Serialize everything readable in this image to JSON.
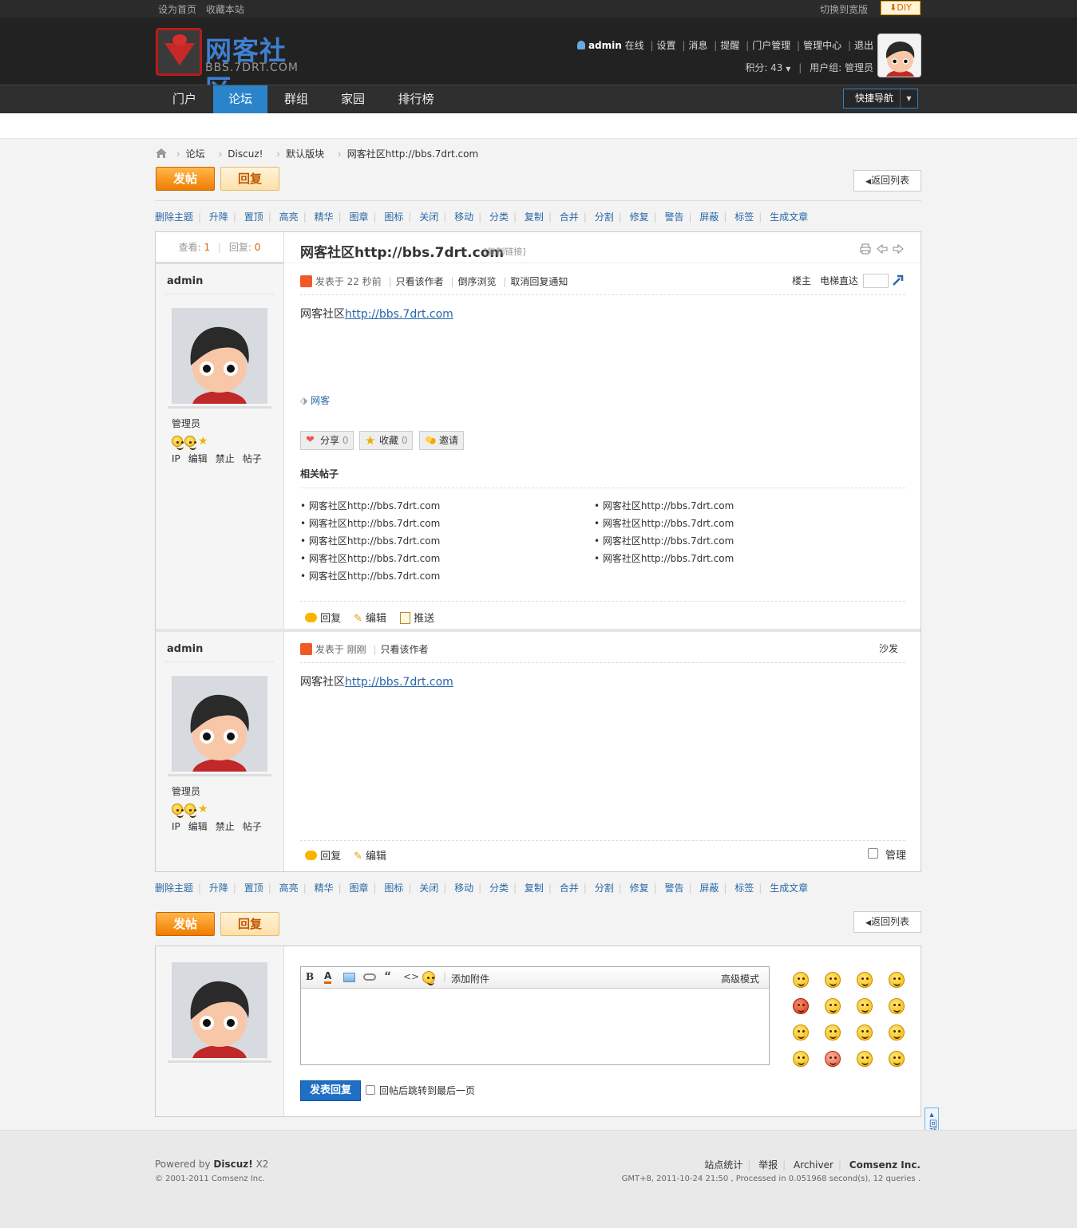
{
  "topbar": {
    "set_home": "设为首页",
    "bookmark": "收藏本站",
    "wide": "切换到宽版",
    "diy": "DIY"
  },
  "logo": {
    "name": "网客社区",
    "domain": "BBS.7DRT.COM"
  },
  "user": {
    "name": "admin",
    "status": "在线",
    "links": [
      "设置",
      "消息",
      "提醒",
      "门户管理",
      "管理中心",
      "退出"
    ],
    "points_label": "积分: 43",
    "group_label": "用户组: 管理员"
  },
  "nav": {
    "items": [
      "门户",
      "论坛",
      "群组",
      "家园",
      "排行榜"
    ],
    "active": "论坛",
    "quick": "快捷导航"
  },
  "breadcrumb": [
    "论坛",
    "Discuz!",
    "默认版块",
    "网客社区http://bbs.7drt.com"
  ],
  "buttons": {
    "post": "发帖",
    "reply": "回复",
    "back": "返回列表"
  },
  "modbar": [
    "删除主题",
    "升降",
    "置顶",
    "高亮",
    "精华",
    "图章",
    "图标",
    "关闭",
    "移动",
    "分类",
    "复制",
    "合并",
    "分割",
    "修复",
    "警告",
    "屏蔽",
    "标签",
    "生成文章"
  ],
  "thread": {
    "views_label": "查看:",
    "views": "1",
    "replies_label": "回复:",
    "replies": "0",
    "title": "网客社区http://bbs.7drt.com",
    "copy_link": "[复制链接]"
  },
  "post1": {
    "author": "admin",
    "posted": "发表于 22 秒前",
    "only_author": "只看该作者",
    "reverse": "倒序浏览",
    "cancel_notify": "取消回复通知",
    "floor": "楼主",
    "jump_label": "电梯直达",
    "content_text": "网客社区",
    "content_link": "http://bbs.7drt.com",
    "tag": "网客",
    "share": "分享",
    "share_count": "0",
    "fav": "收藏",
    "fav_count": "0",
    "invite": "邀请",
    "related_title": "相关帖子",
    "related": [
      "网客社区http://bbs.7drt.com",
      "网客社区http://bbs.7drt.com",
      "网客社区http://bbs.7drt.com",
      "网客社区http://bbs.7drt.com",
      "网客社区http://bbs.7drt.com",
      "网客社区http://bbs.7drt.com",
      "网客社区http://bbs.7drt.com",
      "网客社区http://bbs.7drt.com",
      "网客社区http://bbs.7drt.com"
    ],
    "actions": [
      "回复",
      "编辑",
      "推送"
    ]
  },
  "post2": {
    "author": "admin",
    "posted": "发表于 刚刚",
    "only_author": "只看该作者",
    "floor": "沙发",
    "content_text": "网客社区",
    "content_link": "http://bbs.7drt.com",
    "actions": [
      "回复",
      "编辑"
    ],
    "manage": "管理"
  },
  "side": {
    "group": "管理员",
    "ops": [
      "IP",
      "编辑",
      "禁止",
      "帖子"
    ]
  },
  "editor": {
    "attach": "添加附件",
    "advanced": "高级模式",
    "submit": "发表回复",
    "jump_last": "回帖后跳转到最后一页"
  },
  "back_top": "回顶部",
  "footer": {
    "powered": "Powered by",
    "brand": "Discuz!",
    "version": "X2",
    "copyright": "© 2001-2011 Comsenz Inc.",
    "links": [
      "站点统计",
      "举报",
      "Archiver"
    ],
    "company": "Comsenz Inc.",
    "info": "GMT+8, 2011-10-24 21:50 , Processed in 0.051968 second(s), 12 queries ."
  }
}
